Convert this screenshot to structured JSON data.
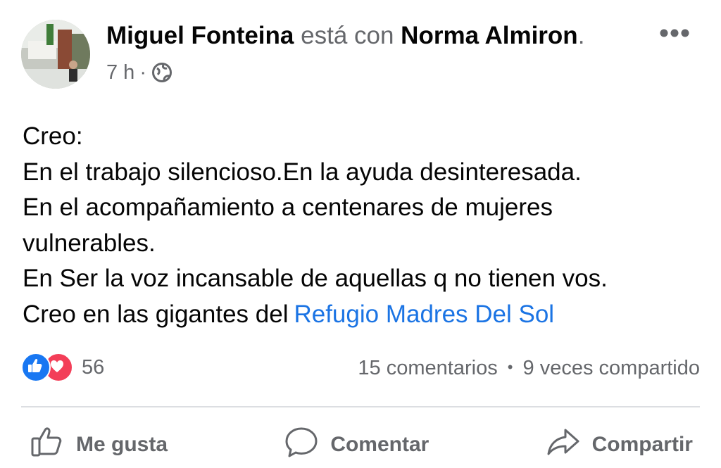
{
  "post": {
    "author": "Miguel Fonteina",
    "with_text": "está con",
    "tagged": "Norma Almiron",
    "tagged_suffix": ".",
    "time": "7 h",
    "separator": "·",
    "privacy_icon": "globe-icon",
    "more_icon": "more-dots-icon",
    "body_lines": [
      "Creo:",
      "En el trabajo silencioso.En la ayuda desinteresada.",
      "En el acompañamiento a centenares de mujeres",
      "vulnerables.",
      "En Ser la voz incansable de aquellas q no tienen vos."
    ],
    "last_line_prefix": "Creo en las gigantes del",
    "page_link": "Refugio Madres Del Sol"
  },
  "reactions": {
    "icons": [
      "like-reaction-icon",
      "love-reaction-icon"
    ],
    "count": "56"
  },
  "stats": {
    "comments": "15 comentarios",
    "separator": "•",
    "shares": "9 veces compartido"
  },
  "actions": {
    "like_label": "Me gusta",
    "comment_label": "Comentar",
    "share_label": "Compartir"
  },
  "colors": {
    "link": "#1b74e4",
    "muted": "#65676b",
    "like": "#1877f2",
    "love": "#f33e58"
  }
}
